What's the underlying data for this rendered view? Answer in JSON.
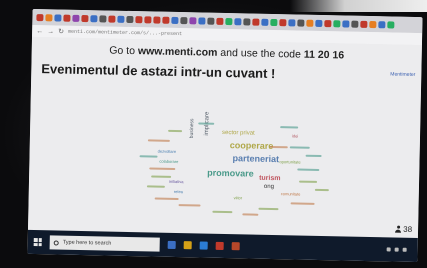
{
  "browser": {
    "url": "menti.com/mentimeter.com/s/...-present"
  },
  "slide": {
    "join_prefix": "Go to ",
    "join_site": "www.menti.com",
    "join_middle": " and use the code ",
    "join_code": "11 20 16",
    "question": "Evenimentul de astazi intr-un cuvant !",
    "brand": "Mentimeter",
    "participants": "38"
  },
  "word_cloud": {
    "words": [
      {
        "text": "parteneriat",
        "color": "#5a7fb0",
        "size": 9
      },
      {
        "text": "cooperare",
        "color": "#b0a84a",
        "size": 9
      },
      {
        "text": "promovare",
        "color": "#4a9a8a",
        "size": 9
      },
      {
        "text": "sector privat",
        "color": "#b0a84a",
        "size": 6
      },
      {
        "text": "implicare",
        "color": "#555f6a",
        "size": 6
      },
      {
        "text": "business",
        "color": "#555f6a",
        "size": 5
      },
      {
        "text": "turism",
        "color": "#c0555f",
        "size": 7
      },
      {
        "text": "ong",
        "color": "#333333",
        "size": 6
      },
      {
        "text": "dezvoltare",
        "color": "#4a7fb0",
        "size": 4
      },
      {
        "text": "oportunitate",
        "color": "#7fa04a",
        "size": 4
      },
      {
        "text": "colaborare",
        "color": "#4a9a8a",
        "size": 4
      },
      {
        "text": "comunitate",
        "color": "#c07a4a",
        "size": 4
      },
      {
        "text": "initiativa",
        "color": "#6a5aa0",
        "size": 4
      },
      {
        "text": "idei",
        "color": "#b0555f",
        "size": 4
      },
      {
        "text": "retea",
        "color": "#4a7fb0",
        "size": 4
      },
      {
        "text": "viitor",
        "color": "#7fa04a",
        "size": 4
      }
    ]
  },
  "taskbar": {
    "search_placeholder": "Type here to search"
  }
}
